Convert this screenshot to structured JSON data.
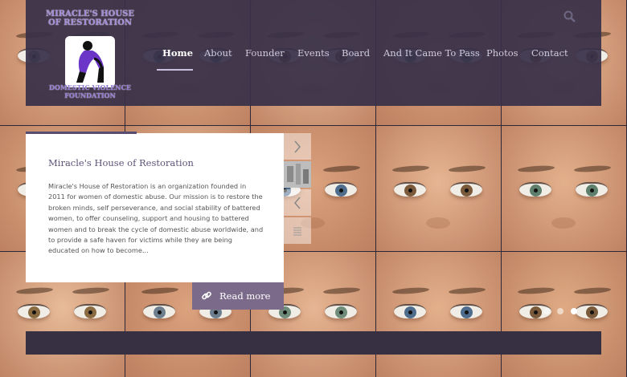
{
  "logo": {
    "top_text": "MIRACLE'S HOUSE OF RESTORATION",
    "bottom_text": "DOMESTIC VIOLENCE FOUNDATION"
  },
  "nav": {
    "items": [
      {
        "label": "Home",
        "active": true
      },
      {
        "label": "About"
      },
      {
        "label": "Founder"
      },
      {
        "label": "Events"
      },
      {
        "label": "Board"
      },
      {
        "label": "And It Came To Pass"
      },
      {
        "label": "Photos"
      },
      {
        "label": "Contact"
      }
    ],
    "search_icon": "search-icon"
  },
  "feature": {
    "title": "Miracle's House of Restoration",
    "body": "Miracle's House of Restoration is an organization founded in 2011 for women of domestic abuse. Our mission is to restore the broken minds, self perseverance, and social stability of battered women, to offer counseling, support and housing to battered women and to break the cycle of domestic abuse worldwide, and to provide a safe haven for victims while they are being educated on how to become...",
    "read_more": "Read more",
    "read_more_icon": "link-icon"
  },
  "slider": {
    "dots": 3,
    "active_dot": 2,
    "next_icon": "chevron-right-icon",
    "prev_icon": "chevron-left-icon",
    "list_icon": "list-icon"
  },
  "colors": {
    "header_bg": "#383048",
    "accent": "#7b6a8a",
    "title": "#5d5378",
    "logo_purple": "#8f78d1"
  }
}
